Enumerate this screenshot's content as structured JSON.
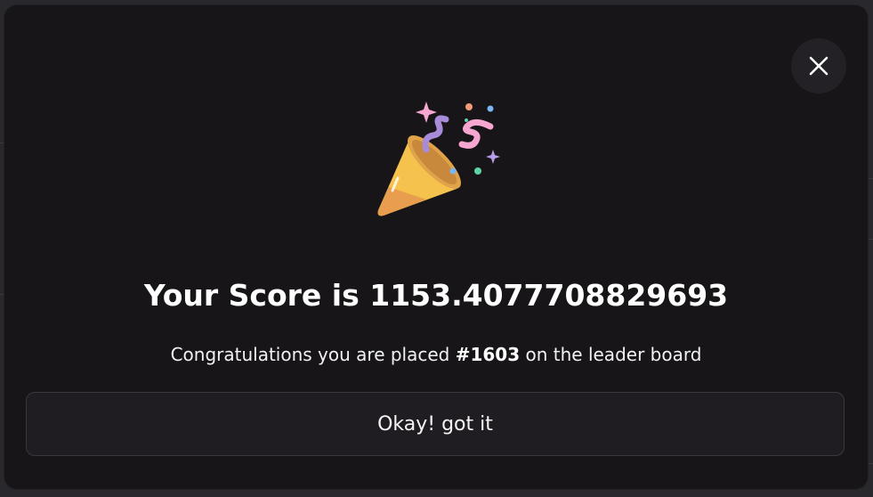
{
  "dialog": {
    "score_prefix": "Your Score is ",
    "score_value": "1153.4077708829693",
    "message_before": "Congratulations you are placed ",
    "rank": "#1603",
    "message_after": " on the leader board",
    "confirm_label": "Okay! got it",
    "close_icon": "close-icon",
    "celebration_icon": "party-popper-icon"
  },
  "colors": {
    "modal_bg": "#171518",
    "text": "#ffffff",
    "button_bg": "#1f1d21",
    "button_border": "#3a383d"
  }
}
